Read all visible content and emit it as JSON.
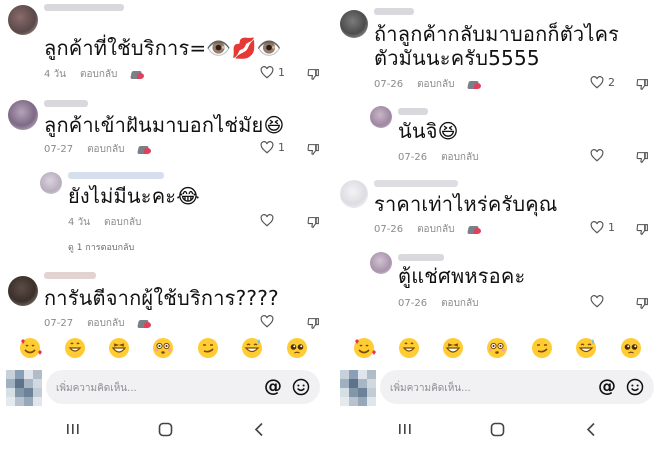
{
  "left": {
    "comments": [
      {
        "text": "ลูกค้าที่ใช้บริการ=👁️💋👁️",
        "time": "4 วัน",
        "reply": "ตอบกลับ",
        "likes": "1"
      },
      {
        "text": "ลูกค้าเข้าฝันมาบอกไช่มัย😆",
        "time": "07-27",
        "reply": "ตอบกลับ",
        "likes": "1"
      },
      {
        "text": "ยังไม่มีนะคะ😂",
        "time": "4 วัน",
        "reply": "ตอบกลับ",
        "likes": ""
      },
      {
        "text": "การันตีจากผู้ใช้บริการ????",
        "time": "07-27",
        "reply": "ตอบกลับ",
        "likes": ""
      }
    ],
    "view_replies": "ดู 1 การตอบกลับ",
    "input_placeholder": "เพิ่มความคิดเห็น..."
  },
  "right": {
    "comments": [
      {
        "text": "ถ้าลูกค้ากลับมาบอกก็ตัวไคร ตัวมันนะครับ5555",
        "time": "07-26",
        "reply": "ตอบกลับ",
        "likes": "2"
      },
      {
        "text": "นันจิ😆",
        "time": "07-26",
        "reply": "ตอบกลับ",
        "likes": ""
      },
      {
        "text": "ราคาเท่าไหร่ครับคุณ",
        "time": "07-26",
        "reply": "ตอบกลับ",
        "likes": "1"
      },
      {
        "text": "ตู้แช่ศพหรอคะ",
        "time": "07-26",
        "reply": "ตอบกลับ",
        "likes": ""
      }
    ],
    "input_placeholder": "เพิ่มความคิดเห็น..."
  },
  "input": {
    "mention_symbol": "@"
  },
  "emojis": [
    "smiling-face-with-hearts",
    "grinning-face",
    "laughing-face",
    "flushed-face",
    "smirking-face",
    "cold-sweat-face",
    "pleading-face"
  ],
  "colors": {
    "like_icon": "#555555",
    "meta_text": "#8a8a8a",
    "input_bg": "#f1f1f3"
  }
}
